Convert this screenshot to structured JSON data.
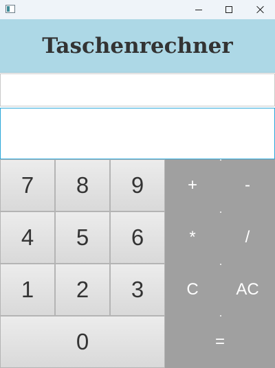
{
  "window": {
    "minimize_icon": "minimize-icon",
    "maximize_icon": "maximize-icon",
    "close_icon": "close-icon"
  },
  "header": {
    "title": "Taschenrechner",
    "background": "#add8e6"
  },
  "displays": {
    "top_value": "",
    "bottom_value": "",
    "bottom_border": "#29a6d9"
  },
  "keypad": {
    "digits": [
      "7",
      "8",
      "9",
      "4",
      "5",
      "6",
      "1",
      "2",
      "3",
      "0"
    ],
    "operators": [
      "+",
      "-",
      "*",
      "/",
      "C",
      "AC",
      "="
    ],
    "operator_background": "#a0a0a0",
    "digit_text_color": "#333333",
    "operator_text_color": "#ffffff"
  }
}
